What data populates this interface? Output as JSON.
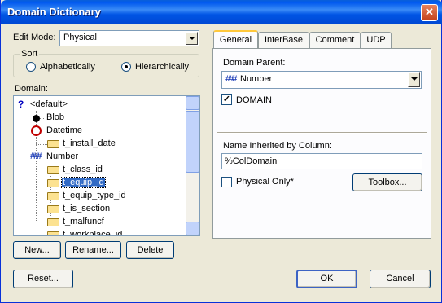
{
  "window": {
    "title": "Domain Dictionary",
    "close_glyph": "✕"
  },
  "edit_mode": {
    "label": "Edit Mode:",
    "value": "Physical"
  },
  "sort": {
    "legend": "Sort",
    "options": [
      "Alphabetically",
      "Hierarchically"
    ],
    "selected": "Hierarchically"
  },
  "domain": {
    "label": "Domain:",
    "tree": [
      {
        "text": "<default>",
        "icon": "question-icon"
      },
      {
        "text": "Blob",
        "icon": "bullet-icon"
      },
      {
        "text": "Datetime",
        "icon": "clock-icon"
      },
      {
        "text": "t_install_date",
        "icon": "folder-icon"
      },
      {
        "text": "Number",
        "icon": "number-icon"
      },
      {
        "text": "t_class_id",
        "icon": "folder-icon"
      },
      {
        "text": "t_equip_id",
        "icon": "folder-icon",
        "selected": true
      },
      {
        "text": "t_equip_type_id",
        "icon": "folder-icon"
      },
      {
        "text": "t_is_section",
        "icon": "folder-icon"
      },
      {
        "text": "t_malfuncf",
        "icon": "folder-icon"
      },
      {
        "text": "t_workplace_id",
        "icon": "folder-icon"
      }
    ]
  },
  "buttons": {
    "new": "New...",
    "rename": "Rename...",
    "delete": "Delete",
    "reset": "Reset...",
    "ok": "OK",
    "cancel": "Cancel",
    "toolbox": "Toolbox..."
  },
  "tabs": [
    "General",
    "InterBase",
    "Comment",
    "UDP"
  ],
  "active_tab": "General",
  "general": {
    "domain_parent_label": "Domain Parent:",
    "domain_parent_value": "Number",
    "domain_checkbox_label": "DOMAIN",
    "domain_checked": true,
    "name_inherited_label": "Name Inherited by Column:",
    "name_inherited_value": "%ColDomain",
    "physical_only_label": "Physical Only*",
    "physical_only_checked": false
  },
  "colors": {
    "title_bar": "#0055e5",
    "selection": "#316ac5",
    "window_bg": "#ece9d8"
  }
}
